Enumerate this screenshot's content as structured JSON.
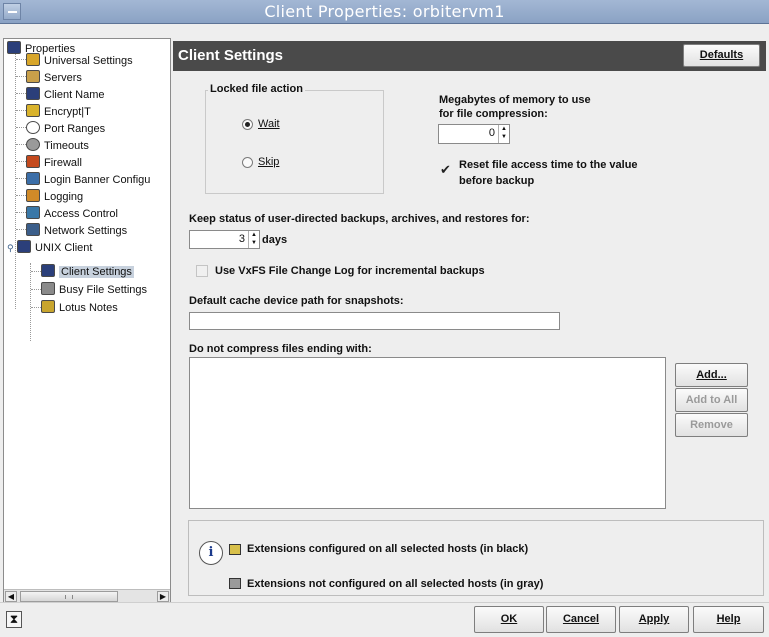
{
  "window": {
    "title": "Client Properties: orbitervm1"
  },
  "tree": {
    "root": "Properties",
    "items": [
      {
        "label": "Universal Settings",
        "icon": "universal-settings-icon",
        "color": "#d8a62a"
      },
      {
        "label": "Servers",
        "icon": "servers-icon",
        "color": "#c9a04a"
      },
      {
        "label": "Client Name",
        "icon": "client-name-icon",
        "color": "#2b3f7a"
      },
      {
        "label": "Encrypt|T",
        "icon": "lock-icon",
        "color": "#d9b32c"
      },
      {
        "label": "Port Ranges",
        "icon": "port-ranges-icon",
        "color": "#777777"
      },
      {
        "label": "Timeouts",
        "icon": "clock-icon",
        "color": "#555555"
      },
      {
        "label": "Firewall",
        "icon": "firewall-icon",
        "color": "#c44a1e"
      },
      {
        "label": "Login Banner Configu",
        "icon": "login-banner-icon",
        "color": "#3b6ea8"
      },
      {
        "label": "Logging",
        "icon": "logging-icon",
        "color": "#d08a28"
      },
      {
        "label": "Access Control",
        "icon": "access-control-icon",
        "color": "#3a78a8"
      },
      {
        "label": "Network Settings",
        "icon": "network-settings-icon",
        "color": "#3b5e8a"
      },
      {
        "label": "UNIX Client",
        "icon": "unix-client-icon",
        "color": "#2b3f7a"
      }
    ],
    "children": [
      {
        "label": "Client Settings",
        "icon": "client-settings-icon",
        "color": "#2b3f7a"
      },
      {
        "label": "Busy File Settings",
        "icon": "busy-file-icon",
        "color": "#555555"
      },
      {
        "label": "Lotus Notes",
        "icon": "lotus-notes-icon",
        "color": "#c8a52e"
      }
    ]
  },
  "panel": {
    "title": "Client Settings",
    "defaults_button": "Defaults",
    "locked_file": {
      "legend": "Locked file action",
      "options": [
        {
          "label": "Wait",
          "selected": true
        },
        {
          "label": "Skip",
          "selected": false
        }
      ]
    },
    "memory": {
      "label_line1": "Megabytes of memory to use",
      "label_line2": "for file compression:",
      "value": "0"
    },
    "reset_access": {
      "line1": "Reset file access time to the value",
      "line2": "before backup",
      "checked": true
    },
    "keep_status": {
      "label": "Keep status of user-directed backups, archives, and restores for:",
      "value": "3",
      "unit": "days"
    },
    "vxfs": {
      "label": "Use VxFS File Change Log for incremental backups",
      "checked": false
    },
    "cache_path": {
      "label": "Default cache device path for snapshots:",
      "value": ""
    },
    "no_compress": {
      "label": "Do not compress files ending with:",
      "add_button": "Add...",
      "add_all_button": "Add to All",
      "remove_button": "Remove"
    },
    "legend": {
      "configured": "Extensions configured on all selected hosts (in black)",
      "not_configured": "Extensions not configured on all selected hosts (in gray)"
    }
  },
  "footer": {
    "ok": "OK",
    "cancel": "Cancel",
    "apply": "Apply",
    "help": "Help"
  }
}
